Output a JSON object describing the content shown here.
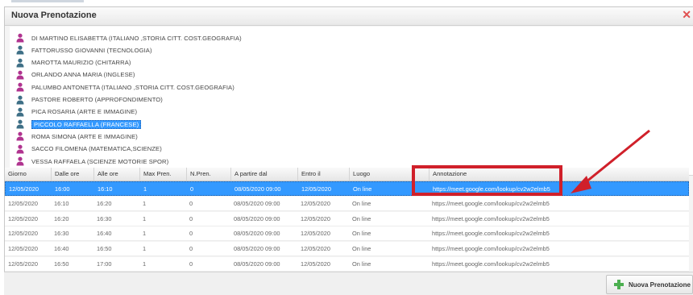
{
  "dialog": {
    "title": "Nuova Prenotazione",
    "close_icon": "close-icon"
  },
  "teachers": [
    {
      "name": "DI MARTINO ELISABETTA (ITALIANO ,STORIA CITT. COST.GEOGRAFIA)",
      "gender": "female"
    },
    {
      "name": "FATTORUSSO GIOVANNI (TECNOLOGIA)",
      "gender": "male"
    },
    {
      "name": "MAROTTA MAURIZIO (CHITARRA)",
      "gender": "male"
    },
    {
      "name": "ORLANDO ANNA MARIA (INGLESE)",
      "gender": "female"
    },
    {
      "name": "PALUMBO ANTONETTA (ITALIANO ,STORIA CITT. COST.GEOGRAFIA)",
      "gender": "female"
    },
    {
      "name": "PASTORE ROBERTO (APPROFONDIMENTO)",
      "gender": "male"
    },
    {
      "name": "PICA ROSARIA (ARTE E IMMAGINE)",
      "gender": "male"
    },
    {
      "name": "PICCOLO RAFFAELLA (FRANCESE)",
      "gender": "male",
      "selected": true
    },
    {
      "name": "ROMA SIMONA (ARTE E IMMAGINE)",
      "gender": "female"
    },
    {
      "name": "SACCO FILOMENA (MATEMATICA,SCIENZE)",
      "gender": "female"
    },
    {
      "name": "VESSA RAFFAELA (SCIENZE MOTORIE SPOR)",
      "gender": "female"
    }
  ],
  "table": {
    "headers": [
      "Giorno",
      "Dalle ore",
      "Alle ore",
      "Max Pren.",
      "N.Pren.",
      "A partire dal",
      "Entro il",
      "Luogo",
      "Annotazione"
    ],
    "rows": [
      [
        "12/05/2020",
        "16:00",
        "16:10",
        "1",
        "0",
        "08/05/2020 09:00",
        "12/05/2020",
        "On line",
        "https://meet.google.com/lookup/cv2w2elmb5"
      ],
      [
        "12/05/2020",
        "16:10",
        "16:20",
        "1",
        "0",
        "08/05/2020 09:00",
        "12/05/2020",
        "On line",
        "https://meet.google.com/lookup/cv2w2elmb5"
      ],
      [
        "12/05/2020",
        "16:20",
        "16:30",
        "1",
        "0",
        "08/05/2020 09:00",
        "12/05/2020",
        "On line",
        "https://meet.google.com/lookup/cv2w2elmb5"
      ],
      [
        "12/05/2020",
        "16:30",
        "16:40",
        "1",
        "0",
        "08/05/2020 09:00",
        "12/05/2020",
        "On line",
        "https://meet.google.com/lookup/cv2w2elmb5"
      ],
      [
        "12/05/2020",
        "16:40",
        "16:50",
        "1",
        "0",
        "08/05/2020 09:00",
        "12/05/2020",
        "On line",
        "https://meet.google.com/lookup/cv2w2elmb5"
      ],
      [
        "12/05/2020",
        "16:50",
        "17:00",
        "1",
        "0",
        "08/05/2020 09:00",
        "12/05/2020",
        "On line",
        "https://meet.google.com/lookup/cv2w2elmb5"
      ]
    ],
    "selected_row": 0
  },
  "footer": {
    "new_booking_label": "Nuova Prenotazione"
  },
  "colors": {
    "selection": "#3399ff",
    "annotation_red": "#d0202a",
    "female_icon": "#b0338f",
    "male_icon": "#3e6f86",
    "plus_icon": "#4caf50"
  },
  "icons": {
    "female": "user-female-icon",
    "male": "user-male-icon",
    "plus": "plus-icon"
  }
}
